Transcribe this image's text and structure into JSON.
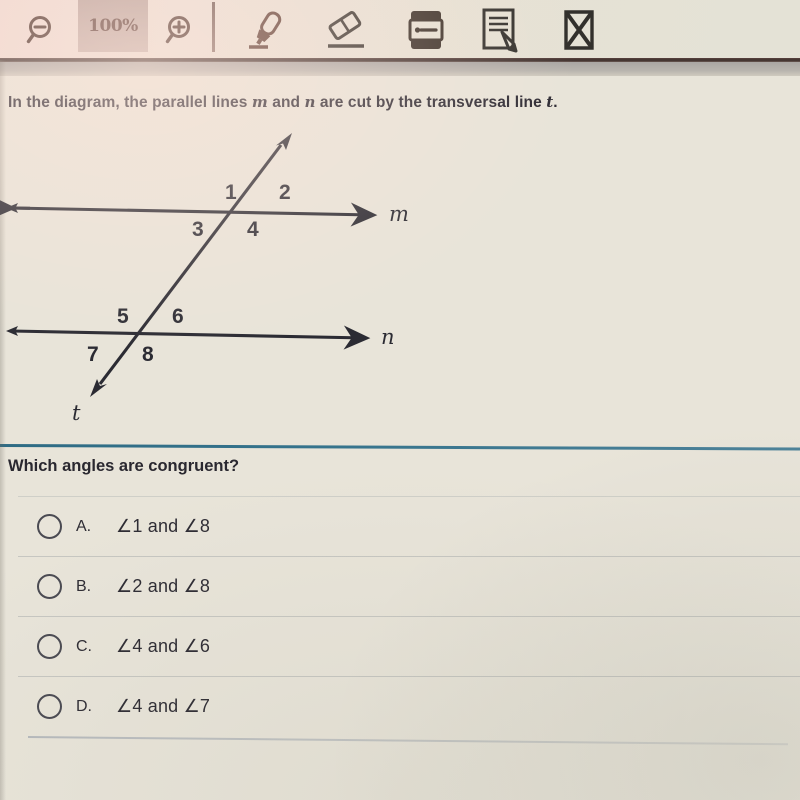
{
  "toolbar": {
    "zoom_out": {
      "name": "zoom-out",
      "label": ""
    },
    "zoom_level": {
      "label": "100%"
    },
    "zoom_in": {
      "name": "zoom-in",
      "label": ""
    },
    "tools": [
      {
        "name": "highlighter-icon",
        "label": "Highlighter"
      },
      {
        "name": "eraser-icon",
        "label": "Eraser"
      },
      {
        "name": "answer-eliminator-icon",
        "label": "Answer Eliminator"
      },
      {
        "name": "notes-icon",
        "label": "Notes"
      },
      {
        "name": "cross-out-icon",
        "label": "Cross Out"
      }
    ]
  },
  "question": {
    "stem_pre": "In the diagram, the parallel lines ",
    "stem_m": "m",
    "stem_mid": " and ",
    "stem_n": "n",
    "stem_post": " are cut by the transversal line ",
    "stem_t": "t",
    "stem_end": ".",
    "prompt": "Which angles are congruent?"
  },
  "diagram": {
    "line_m_label": "m",
    "line_n_label": "n",
    "line_t_label": "t",
    "angle_labels": [
      "1",
      "2",
      "3",
      "4",
      "5",
      "6",
      "7",
      "8"
    ],
    "stroke_color": "#2b2b33"
  },
  "choices": [
    {
      "letter": "A.",
      "text": "∠1 and ∠8",
      "selected": false
    },
    {
      "letter": "B.",
      "text": "∠2 and ∠8",
      "selected": false
    },
    {
      "letter": "C.",
      "text": "∠4 and ∠6",
      "selected": false
    },
    {
      "letter": "D.",
      "text": "∠4 and ∠7",
      "selected": false
    }
  ],
  "colors": {
    "page_background": "#e8e4d9",
    "toolbar_background": "#e9ded4",
    "divider_teal": "#2e6b84",
    "text": "#2d2a33",
    "zoom_label": "#5a3a34"
  }
}
